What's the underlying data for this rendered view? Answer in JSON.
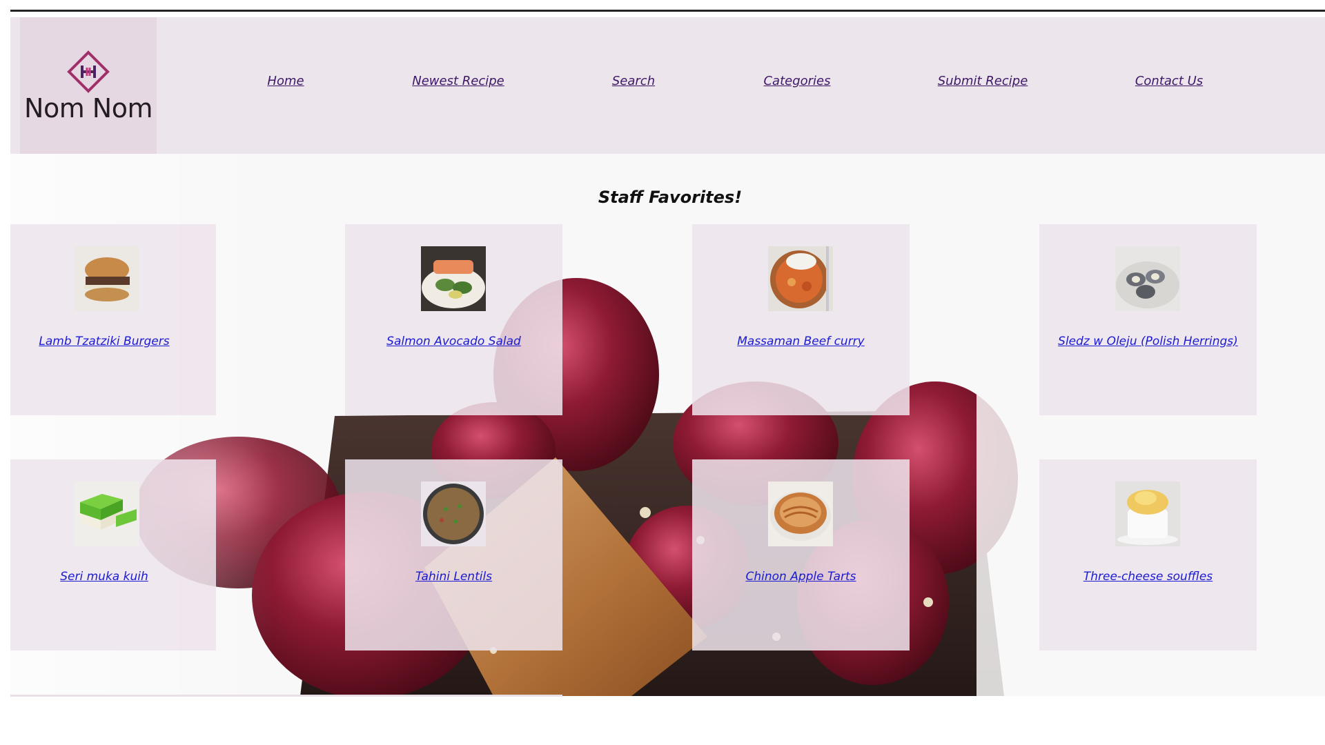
{
  "brand": {
    "name": "Nom Nom"
  },
  "nav": {
    "items": [
      {
        "label": "Home"
      },
      {
        "label": "Newest Recipe"
      },
      {
        "label": "Search"
      },
      {
        "label": "Categories"
      },
      {
        "label": "Submit Recipe"
      },
      {
        "label": "Contact Us"
      }
    ]
  },
  "main": {
    "title": "Staff Favorites!",
    "recipes": [
      {
        "name": "Lamb Tzatziki Burgers",
        "thumb": "burger-photo"
      },
      {
        "name": "Salmon Avocado Salad",
        "thumb": "salmon-salad-photo"
      },
      {
        "name": "Massaman Beef curry",
        "thumb": "beef-curry-photo"
      },
      {
        "name": "Sledz w Oleju (Polish Herrings)",
        "thumb": "herring-rolls-photo"
      },
      {
        "name": "Seri muka kuih",
        "thumb": "green-layer-cake-photo"
      },
      {
        "name": "Tahini Lentils",
        "thumb": "lentils-pan-photo"
      },
      {
        "name": "Chinon Apple Tarts",
        "thumb": "apple-tart-photo"
      },
      {
        "name": "Three-cheese souffles",
        "thumb": "souffle-photo"
      }
    ]
  },
  "colors": {
    "header_bg": "#ece6ec",
    "logo_bg": "#e6d8e3",
    "nav_link": "#3d1766",
    "recipe_link": "#1a1ad1",
    "brand_accent": "#a0306a"
  }
}
